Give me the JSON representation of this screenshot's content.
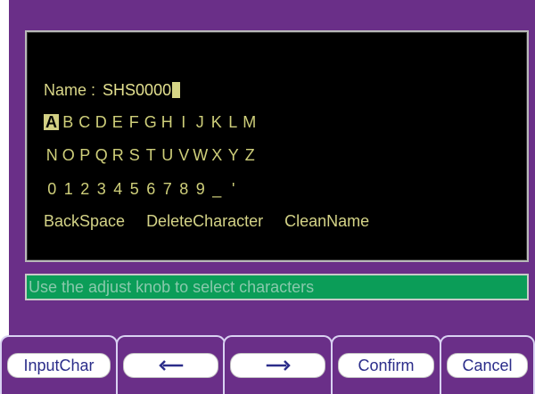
{
  "editor": {
    "name_label": "Name :",
    "name_value": "SHS0000",
    "rows": [
      [
        "A",
        "B",
        "C",
        "D",
        "E",
        "F",
        "G",
        "H",
        "I",
        "J",
        "K",
        "L",
        "M"
      ],
      [
        "N",
        "O",
        "P",
        "Q",
        "R",
        "S",
        "T",
        "U",
        "V",
        "W",
        "X",
        "Y",
        "Z"
      ],
      [
        "0",
        "1",
        "2",
        "3",
        "4",
        "5",
        "6",
        "7",
        "8",
        "9",
        "_",
        "'"
      ]
    ],
    "selected_char": "A",
    "actions": [
      "BackSpace",
      "DeleteCharacter",
      "CleanName"
    ]
  },
  "status": {
    "text": "Use the adjust knob to select characters"
  },
  "softkeys": [
    {
      "label": "InputChar"
    },
    {
      "label": "",
      "icon": "left-arrow-icon"
    },
    {
      "label": "",
      "icon": "right-arrow-icon"
    },
    {
      "label": "Confirm"
    },
    {
      "label": "Cancel"
    }
  ],
  "colors": {
    "purple": "#6a2f88",
    "black": "#000000",
    "text_yellow": "#cfcf7a",
    "status_green": "#0b9d58",
    "softkey_text": "#2b2d8a"
  }
}
